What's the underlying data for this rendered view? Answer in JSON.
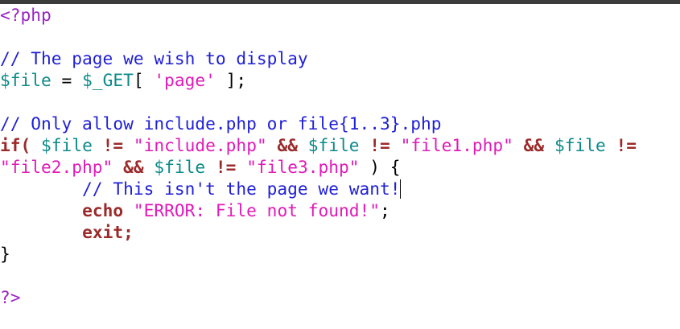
{
  "editor": {
    "lines": [
      [
        {
          "t": "<?php",
          "k": "php"
        }
      ],
      [],
      [
        {
          "t": "// The page we wish to display",
          "k": "comment"
        }
      ],
      [
        {
          "t": "$file",
          "k": "var"
        },
        {
          "t": " = ",
          "k": "plain"
        },
        {
          "t": "$_GET",
          "k": "var"
        },
        {
          "t": "[ ",
          "k": "plain"
        },
        {
          "t": "'page'",
          "k": "string"
        },
        {
          "t": " ];",
          "k": "plain"
        }
      ],
      [],
      [
        {
          "t": "// Only allow include.php or file{1..3}.php",
          "k": "comment"
        }
      ],
      [
        {
          "t": "if(",
          "k": "keyword"
        },
        {
          "t": " ",
          "k": "plain"
        },
        {
          "t": "$file",
          "k": "var"
        },
        {
          "t": " ",
          "k": "plain"
        },
        {
          "t": "!=",
          "k": "operator"
        },
        {
          "t": " ",
          "k": "plain"
        },
        {
          "t": "\"include.php\"",
          "k": "string"
        },
        {
          "t": " ",
          "k": "plain"
        },
        {
          "t": "&&",
          "k": "operator"
        },
        {
          "t": " ",
          "k": "plain"
        },
        {
          "t": "$file",
          "k": "var"
        },
        {
          "t": " ",
          "k": "plain"
        },
        {
          "t": "!=",
          "k": "operator"
        },
        {
          "t": " ",
          "k": "plain"
        },
        {
          "t": "\"file1.php\"",
          "k": "string"
        },
        {
          "t": " ",
          "k": "plain"
        },
        {
          "t": "&&",
          "k": "operator"
        },
        {
          "t": " ",
          "k": "plain"
        },
        {
          "t": "$file",
          "k": "var"
        },
        {
          "t": " ",
          "k": "plain"
        },
        {
          "t": "!=",
          "k": "operator"
        }
      ],
      [
        {
          "t": "\"file2.php\"",
          "k": "string"
        },
        {
          "t": " ",
          "k": "plain"
        },
        {
          "t": "&&",
          "k": "operator"
        },
        {
          "t": " ",
          "k": "plain"
        },
        {
          "t": "$file",
          "k": "var"
        },
        {
          "t": " ",
          "k": "plain"
        },
        {
          "t": "!=",
          "k": "operator"
        },
        {
          "t": " ",
          "k": "plain"
        },
        {
          "t": "\"file3.php\"",
          "k": "string"
        },
        {
          "t": " ) {",
          "k": "plain"
        }
      ],
      [
        {
          "t": "        // This isn't the page we want!",
          "k": "comment"
        },
        {
          "t": "",
          "k": "cursor"
        }
      ],
      [
        {
          "t": "        ",
          "k": "plain"
        },
        {
          "t": "echo",
          "k": "keyword"
        },
        {
          "t": " ",
          "k": "plain"
        },
        {
          "t": "\"ERROR: File not found!\"",
          "k": "string"
        },
        {
          "t": ";",
          "k": "plain"
        }
      ],
      [
        {
          "t": "        ",
          "k": "plain"
        },
        {
          "t": "exit;",
          "k": "keyword"
        }
      ],
      [
        {
          "t": "}",
          "k": "plain"
        }
      ],
      [],
      [
        {
          "t": "?>",
          "k": "php"
        }
      ]
    ]
  },
  "colors": {
    "comment": "#1f1fd6",
    "variable": "#0d8a8a",
    "string": "#e01ab8",
    "keyword": "#9b2b2b",
    "php_tag": "#9a24c4",
    "topbar": "#3c3c3c",
    "background": "#ffffff"
  }
}
